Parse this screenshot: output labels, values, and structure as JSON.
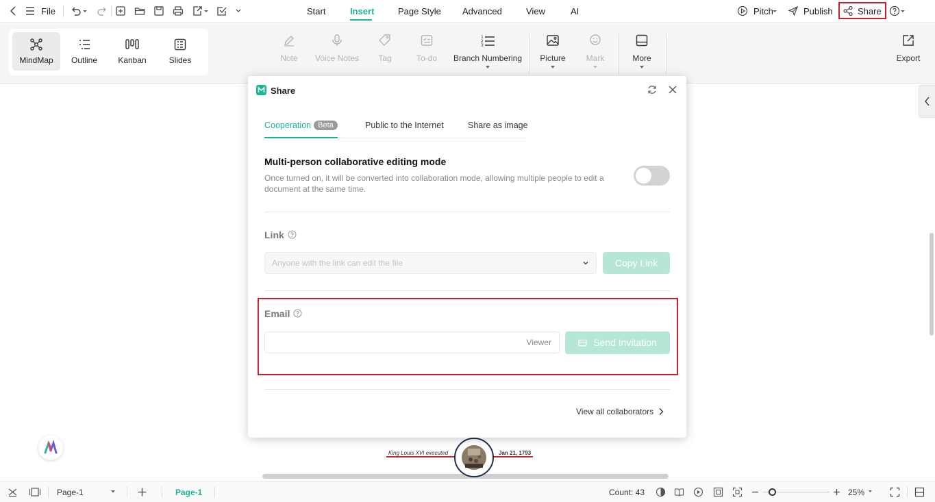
{
  "topbar": {
    "file_label": "File",
    "menu_tabs": [
      "Start",
      "Insert",
      "Page Style",
      "Advanced",
      "View",
      "AI"
    ],
    "active_tab": "Insert",
    "pitch_label": "Pitch",
    "publish_label": "Publish",
    "share_label": "Share"
  },
  "ribbon": {
    "views": [
      "MindMap",
      "Outline",
      "Kanban",
      "Slides"
    ],
    "active_view": "MindMap",
    "tools": {
      "note": "Note",
      "voice_notes": "Voice Notes",
      "tag": "Tag",
      "todo": "To-do",
      "branch_numbering": "Branch Numbering",
      "picture": "Picture",
      "mark": "Mark",
      "more": "More",
      "export": "Export"
    }
  },
  "dialog": {
    "title": "Share",
    "tabs": {
      "cooperation": "Cooperation",
      "beta": "Beta",
      "public": "Public to the Internet",
      "image": "Share as image"
    },
    "collab": {
      "title": "Multi-person collaborative editing mode",
      "description": "Once turned on, it will be converted into collaboration mode, allowing multiple people to edit a document at the same time.",
      "enabled": false
    },
    "link": {
      "label": "Link",
      "select_value": "Anyone with the link can edit the file",
      "copy_button": "Copy Link"
    },
    "email": {
      "label": "Email",
      "value": "",
      "role": "Viewer",
      "send_button": "Send Invitation"
    },
    "view_all": "View all collaborators"
  },
  "canvas": {
    "timeline_left_text": "King Louis XVI executed",
    "timeline_right_text": "Jan 21, 1793"
  },
  "statusbar": {
    "page_select": "Page-1",
    "page_tab": "Page-1",
    "count": "Count: 43",
    "zoom": "25%",
    "zoom_fraction": 0.1
  },
  "colors": {
    "accent": "#1ab394",
    "highlight_red": "#c9202a",
    "timeline_red": "#c0282d",
    "disabled_green": "#b5e6d7"
  }
}
